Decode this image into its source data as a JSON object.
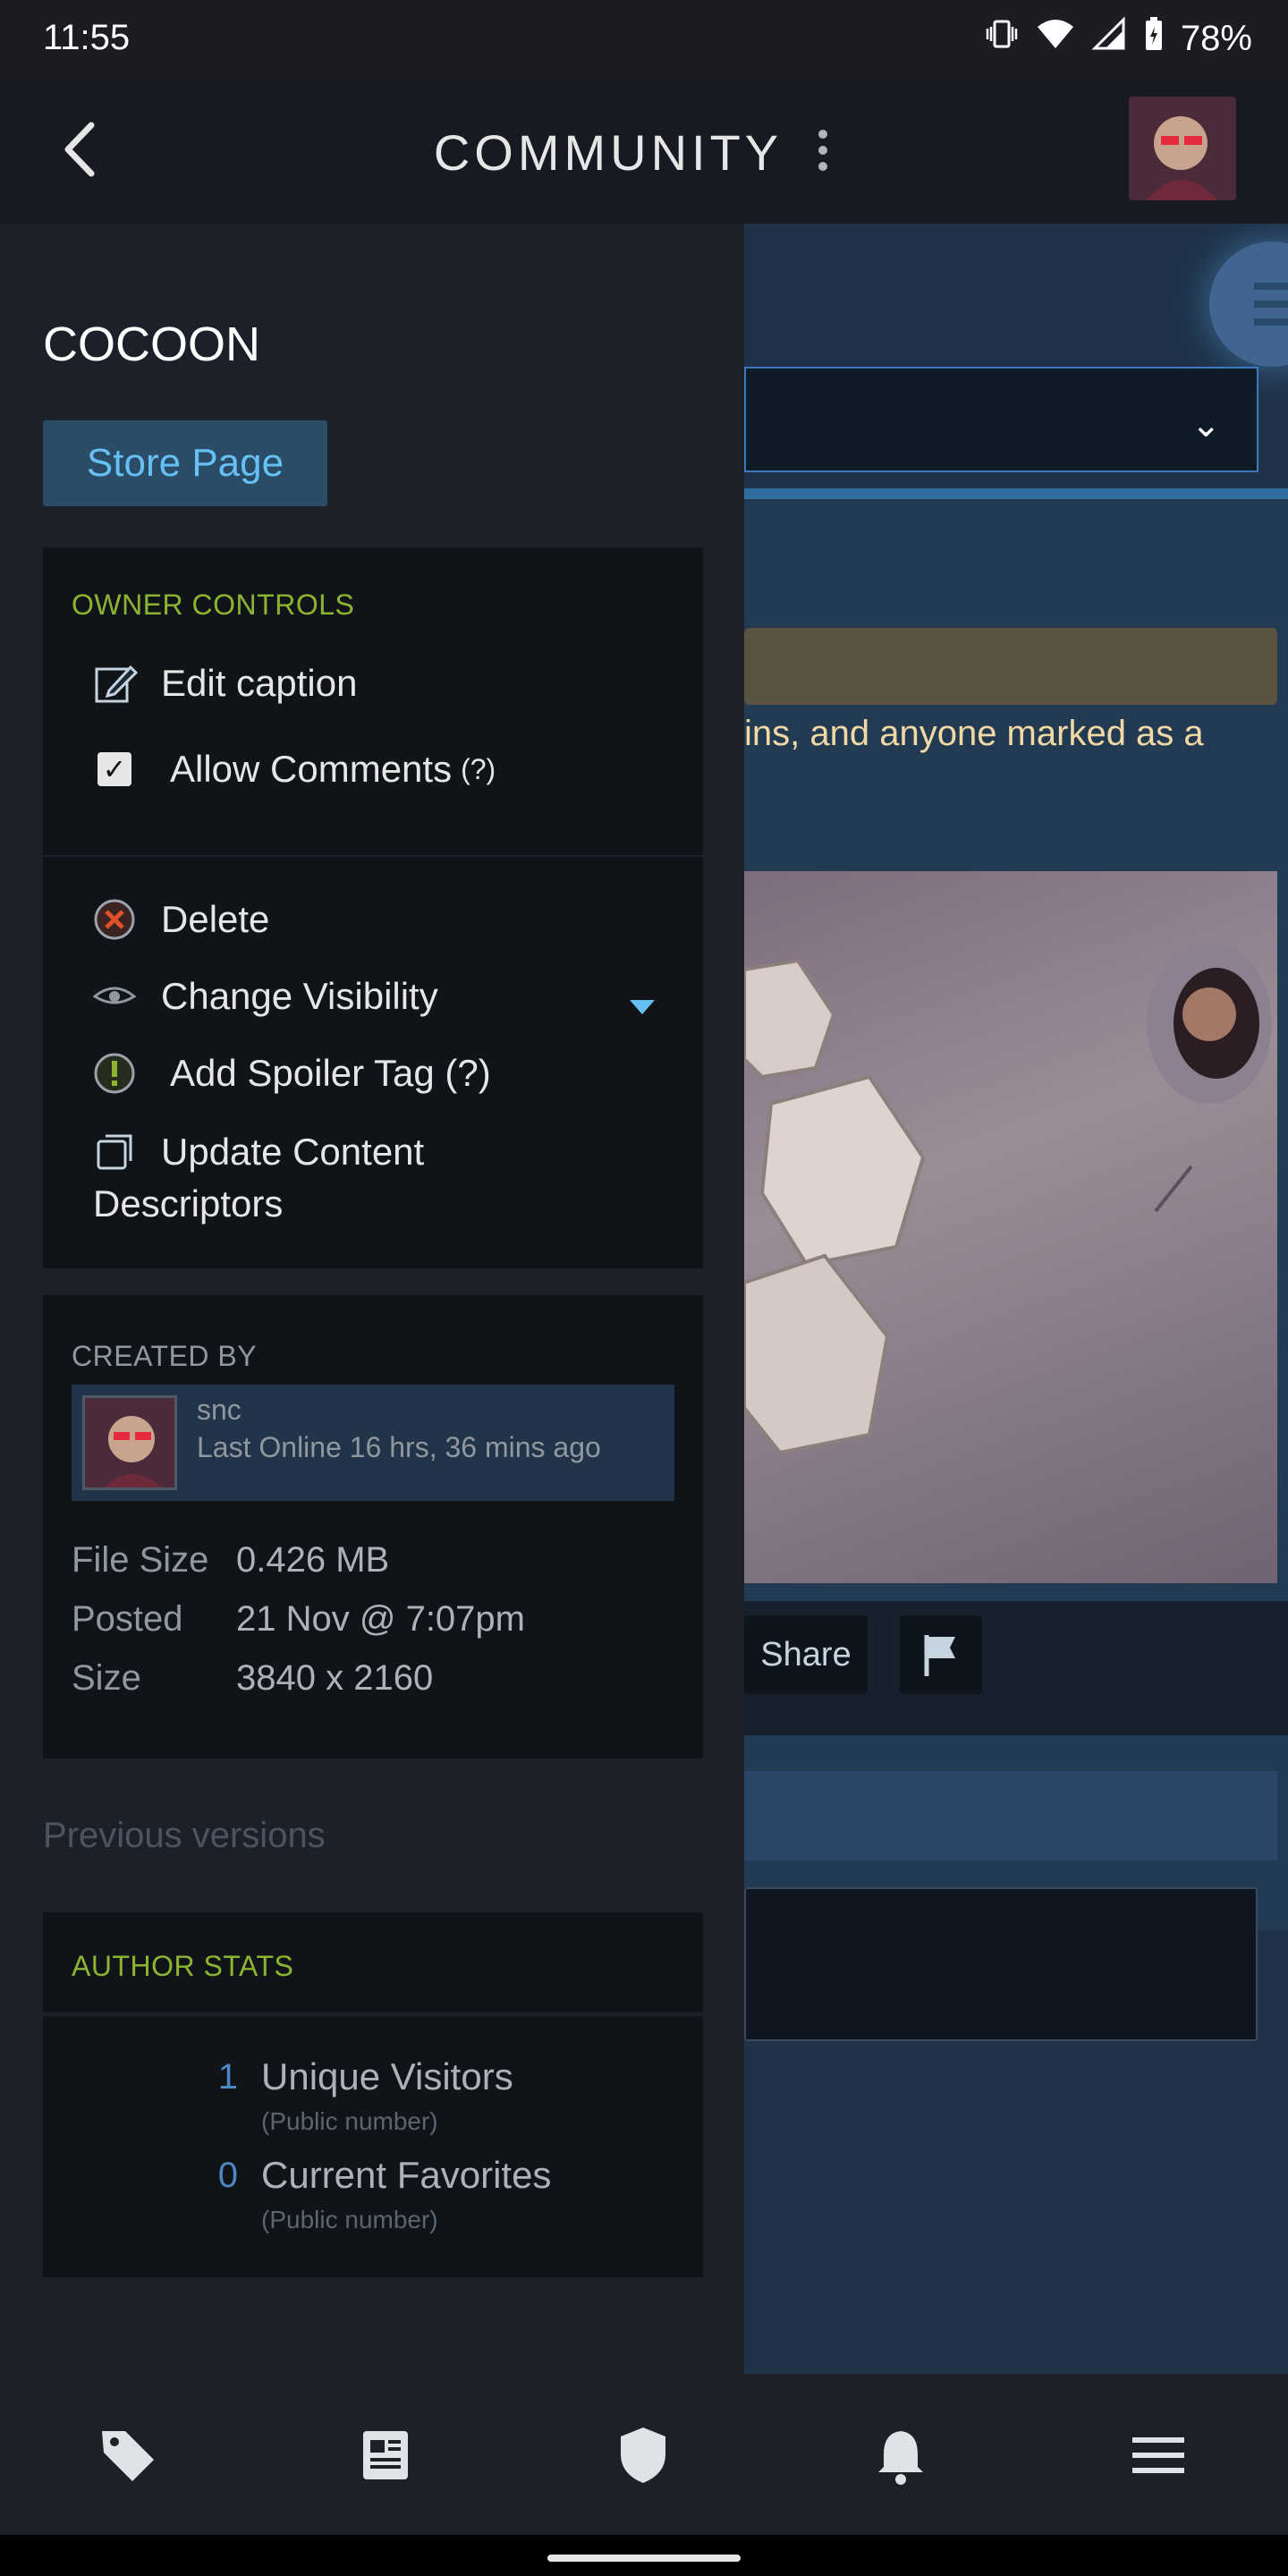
{
  "status_bar": {
    "time": "11:55",
    "battery": "78%"
  },
  "app_bar": {
    "title": "COMMUNITY"
  },
  "background_page": {
    "warning_text": "ins, and anyone marked as a",
    "share_label": "Share"
  },
  "drawer": {
    "game_title": "COCOON",
    "store_button": "Store Page",
    "owner_controls": {
      "heading": "OWNER CONTROLS",
      "edit_caption": "Edit caption",
      "allow_comments": "Allow Comments",
      "allow_comments_help": "(?)",
      "allow_comments_checked": true,
      "delete": "Delete",
      "change_visibility": "Change Visibility",
      "add_spoiler_tag": "Add Spoiler Tag (?)",
      "update_descriptors_line1": "Update Content",
      "update_descriptors_line2": "Descriptors"
    },
    "created_by": {
      "heading": "CREATED BY",
      "name": "snc",
      "last_online": "Last Online 16 hrs, 36 mins ago",
      "file_size_label": "File Size",
      "file_size_value": "0.426 MB",
      "posted_label": "Posted",
      "posted_value": "21 Nov @ 7:07pm",
      "size_label": "Size",
      "size_value": "3840 x 2160"
    },
    "previous_versions": "Previous versions",
    "author_stats": {
      "heading": "AUTHOR STATS",
      "items": [
        {
          "number": "1",
          "label": "Unique Visitors",
          "sub": "(Public number)"
        },
        {
          "number": "0",
          "label": "Current Favorites",
          "sub": "(Public number)"
        }
      ]
    }
  },
  "bottom_nav": {
    "icons": [
      "tag-icon",
      "news-icon",
      "shield-icon",
      "bell-icon",
      "menu-icon"
    ]
  },
  "colors": {
    "accent_blue": "#66c0f4",
    "owner_green": "#8bb530",
    "stat_blue": "#4b88c4"
  }
}
